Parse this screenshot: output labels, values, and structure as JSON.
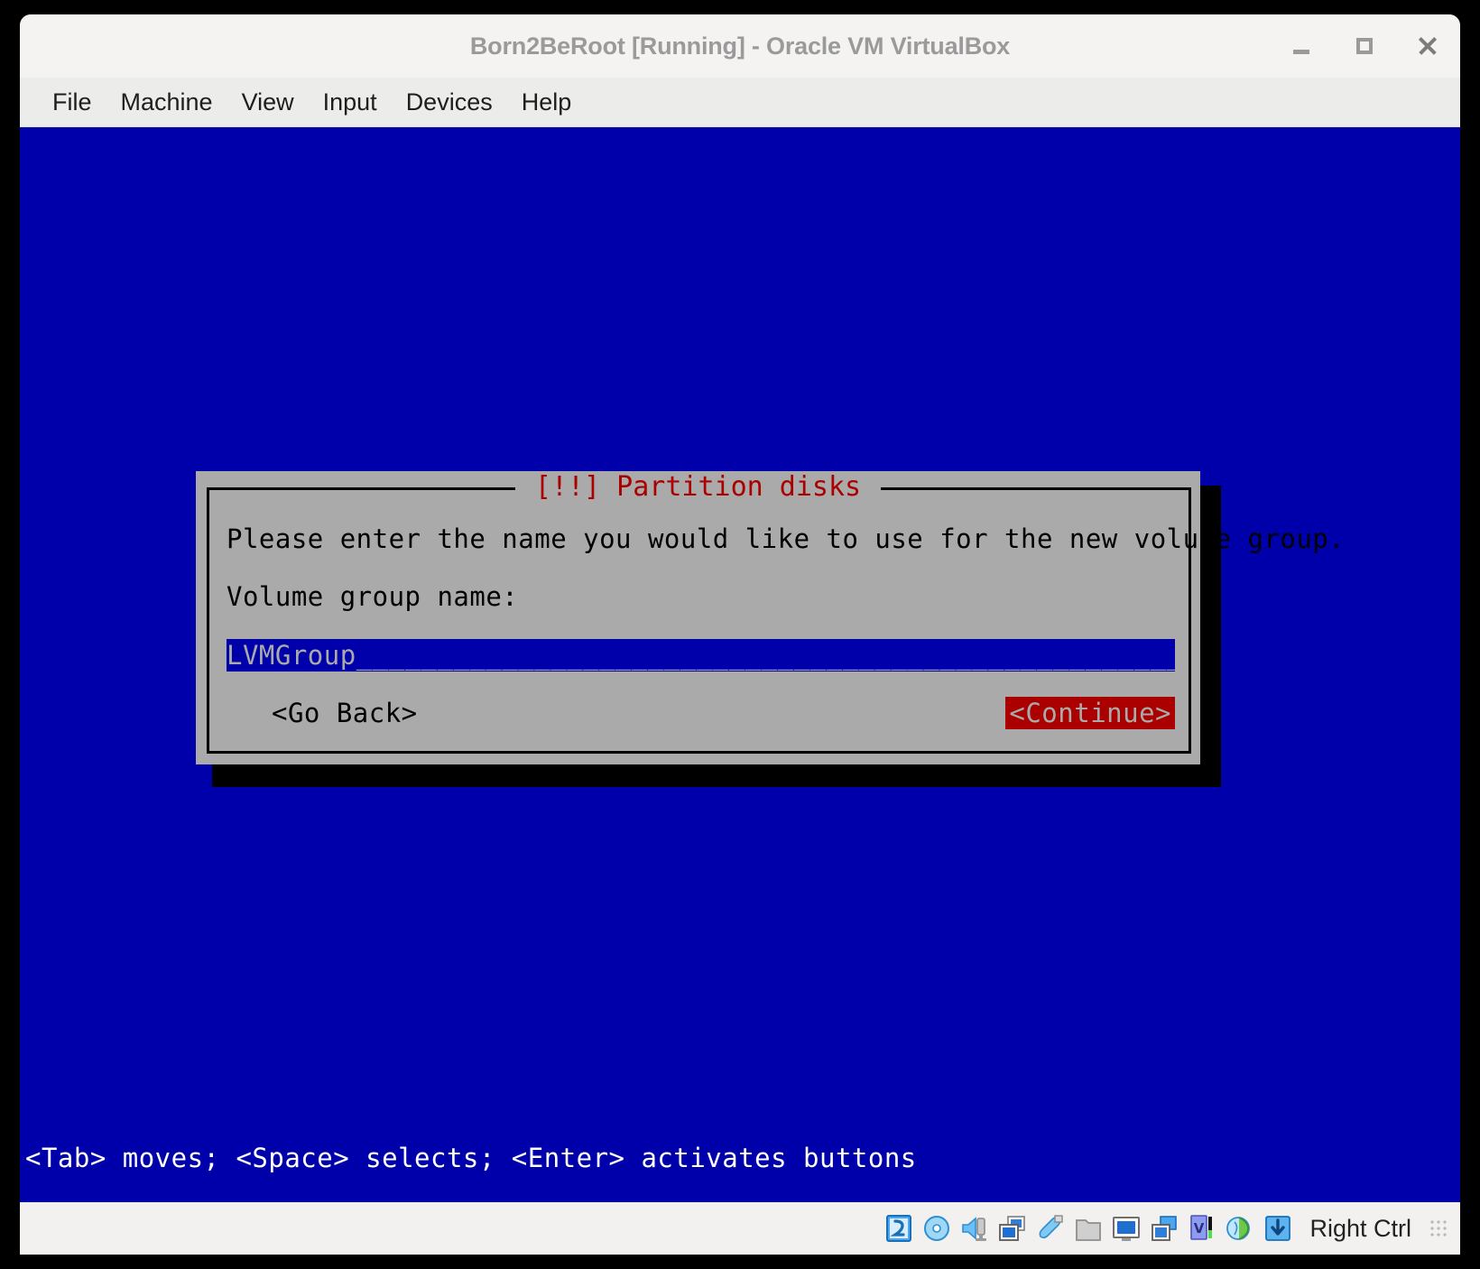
{
  "window": {
    "title": "Born2BeRoot [Running] - Oracle VM VirtualBox",
    "controls": {
      "minimize": "minimize-icon",
      "maximize": "maximize-icon",
      "close": "close-icon"
    }
  },
  "menubar": {
    "items": [
      {
        "label": "File"
      },
      {
        "label": "Machine"
      },
      {
        "label": "View"
      },
      {
        "label": "Input"
      },
      {
        "label": "Devices"
      },
      {
        "label": "Help"
      }
    ]
  },
  "installer": {
    "screen_background": "#0000aa",
    "dialog": {
      "title": "[!!] Partition disks",
      "title_color": "#aa0000",
      "background": "#aaaaaa",
      "prompt": "Please enter the name you would like to use for the new volume group.",
      "field_label": "Volume group name:",
      "input": {
        "value": "LVMGroup",
        "filler": "________________________________________________________",
        "background": "#0000aa",
        "text_color": "#aaaaaa"
      },
      "buttons": [
        {
          "label": "<Go Back>",
          "selected": false
        },
        {
          "label": "<Continue>",
          "selected": true,
          "selected_background": "#aa0000"
        }
      ]
    },
    "help_line": "<Tab> moves; <Space> selects; <Enter> activates buttons"
  },
  "statusbar": {
    "icons": [
      {
        "name": "hard-disk-icon"
      },
      {
        "name": "optical-disk-icon"
      },
      {
        "name": "audio-icon"
      },
      {
        "name": "network-icon"
      },
      {
        "name": "usb-icon"
      },
      {
        "name": "shared-folders-icon"
      },
      {
        "name": "display-icon"
      },
      {
        "name": "recording-icon"
      },
      {
        "name": "vm-cpu-icon"
      },
      {
        "name": "mouse-integration-icon"
      },
      {
        "name": "keyboard-capture-icon"
      }
    ],
    "host_key": "Right Ctrl"
  }
}
